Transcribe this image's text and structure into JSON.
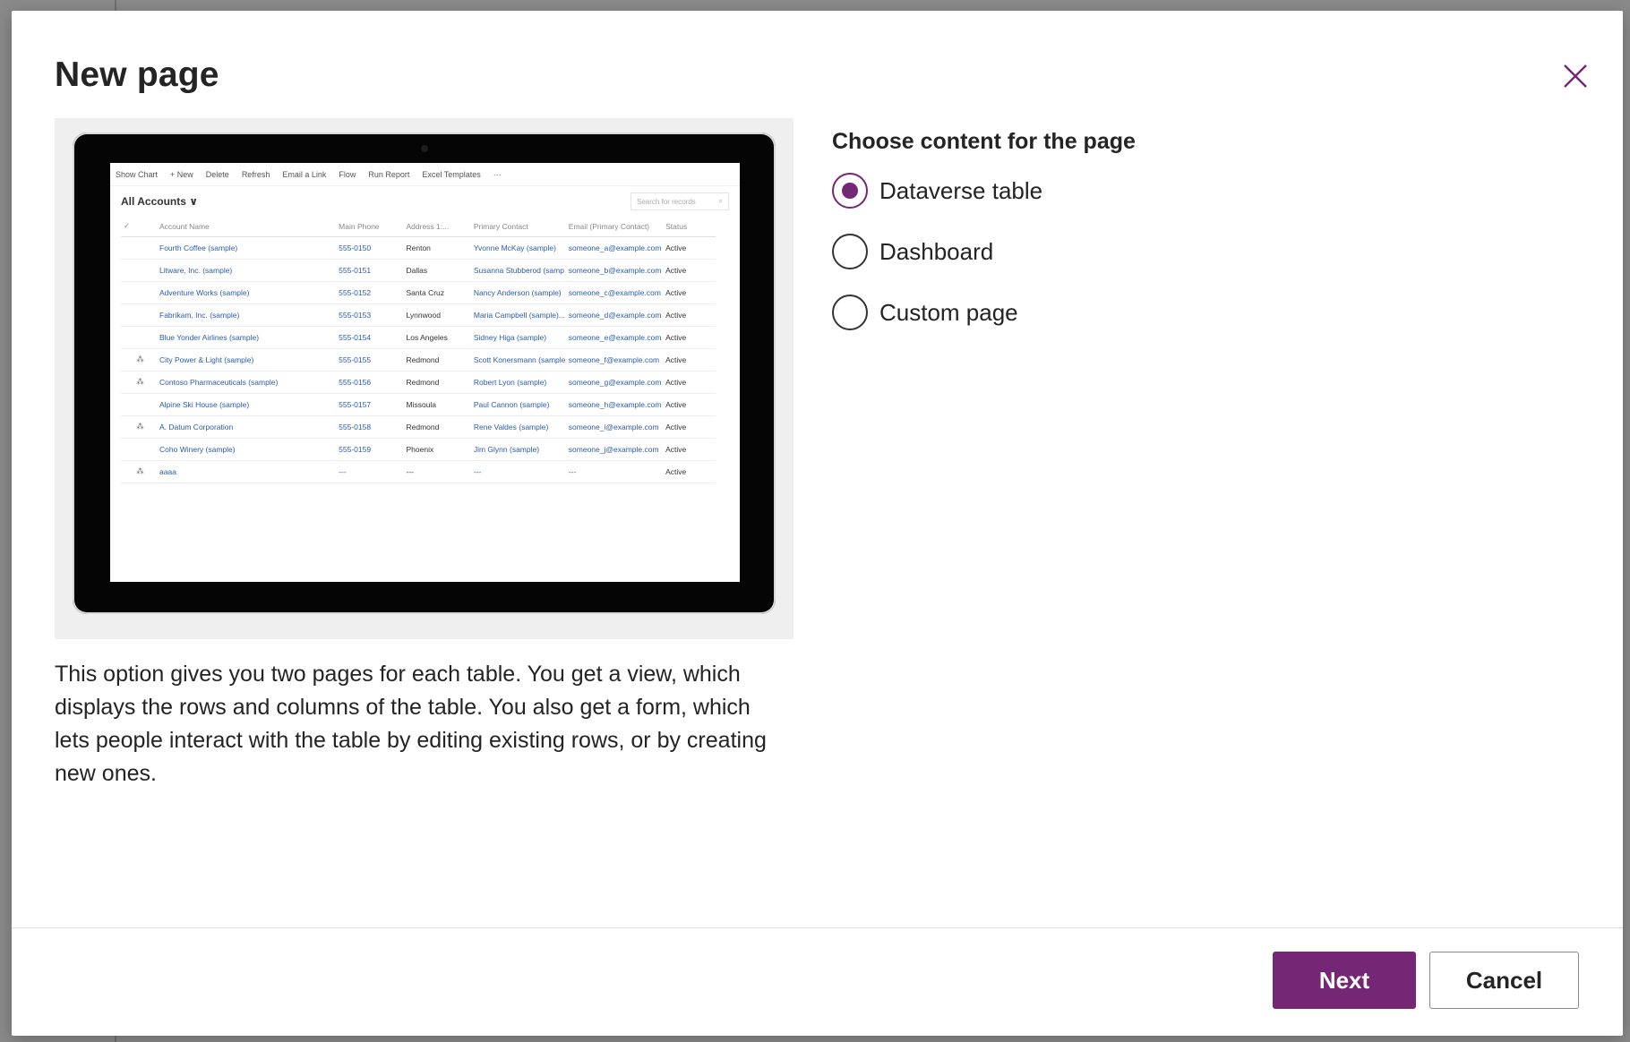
{
  "dialog": {
    "title": "New page",
    "close_icon": "close-icon"
  },
  "preview": {
    "toolbar": [
      "Show Chart",
      "+ New",
      "Delete",
      "Refresh",
      "Email a Link",
      "Flow",
      "Run Report",
      "Excel Templates",
      "···"
    ],
    "view_title": "All Accounts ∨",
    "search_placeholder": "Search for records",
    "columns": [
      "✓",
      "Account Name",
      "Main Phone",
      "Address 1:...",
      "Primary Contact",
      "Email (Primary Contact)",
      "Status"
    ],
    "rows": [
      [
        "",
        "Fourth Coffee (sample)",
        "555-0150",
        "Renton",
        "Yvonne McKay (sample)",
        "someone_a@example.com",
        "Active"
      ],
      [
        "",
        "Litware, Inc. (sample)",
        "555-0151",
        "Dallas",
        "Susanna Stubberod (samp",
        "someone_b@example.com",
        "Active"
      ],
      [
        "",
        "Adventure Works (sample)",
        "555-0152",
        "Santa Cruz",
        "Nancy Anderson (sample)",
        "someone_c@example.com",
        "Active"
      ],
      [
        "",
        "Fabrikam, Inc. (sample)",
        "555-0153",
        "Lynnwood",
        "Maria Campbell (sample)...",
        "someone_d@example.com",
        "Active"
      ],
      [
        "",
        "Blue Yonder Airlines (sample)",
        "555-0154",
        "Los Angeles",
        "Sidney Higa (sample)",
        "someone_e@example.com",
        "Active"
      ],
      [
        "⁂",
        "City Power & Light (sample)",
        "555-0155",
        "Redmond",
        "Scott Konersmann (sample",
        "someone_f@example.com",
        "Active"
      ],
      [
        "⁂",
        "Contoso Pharmaceuticals (sample)",
        "555-0156",
        "Redmond",
        "Robert Lyon (sample)",
        "someone_g@example.com",
        "Active"
      ],
      [
        "",
        "Alpine Ski House (sample)",
        "555-0157",
        "Missoula",
        "Paul Cannon (sample)",
        "someone_h@example.com",
        "Active"
      ],
      [
        "⁂",
        "A. Datum Corporation",
        "555-0158",
        "Redmond",
        "Rene Valdes (sample)",
        "someone_i@example.com",
        "Active"
      ],
      [
        "",
        "Coho Winery (sample)",
        "555-0159",
        "Phoenix",
        "Jim Glynn (sample)",
        "someone_j@example.com",
        "Active"
      ],
      [
        "⁂",
        "aaaa",
        "---",
        "---",
        "---",
        "---",
        "Active"
      ]
    ]
  },
  "description": "This option gives you two pages for each table. You get a view, which displays the rows and columns of the table. You also get a form, which lets people interact with the table by editing existing rows, or by creating new ones.",
  "options": {
    "heading": "Choose content for the page",
    "items": [
      {
        "label": "Dataverse table",
        "selected": true
      },
      {
        "label": "Dashboard",
        "selected": false
      },
      {
        "label": "Custom page",
        "selected": false
      }
    ]
  },
  "footer": {
    "next_label": "Next",
    "cancel_label": "Cancel"
  },
  "colors": {
    "accent": "#742774",
    "text": "#242424",
    "overlay": "#8a8a8a"
  }
}
